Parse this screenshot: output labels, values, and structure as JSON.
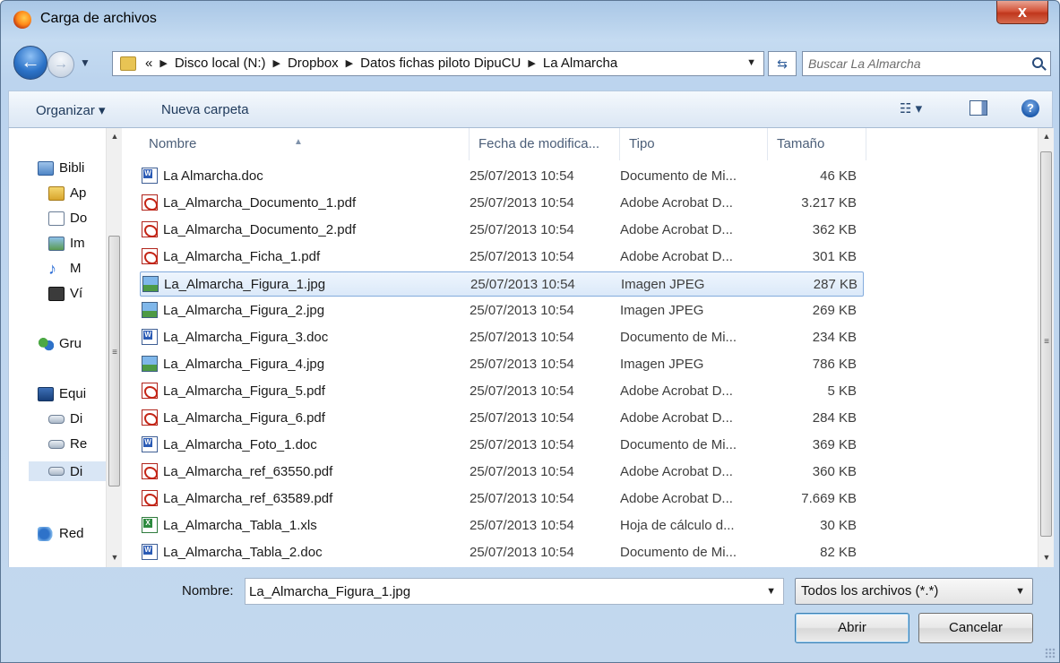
{
  "window": {
    "title": "Carga de archivos",
    "close_label": "x"
  },
  "address": {
    "overflow": "«",
    "crumbs": [
      "Disco local (N:)",
      "Dropbox",
      "Datos fichas piloto DipuCU",
      "La Almarcha"
    ],
    "search_placeholder": "Buscar La Almarcha"
  },
  "toolbar": {
    "organize": "Organizar ▾",
    "new_folder": "Nueva carpeta",
    "views": "☷ ▾",
    "help": "?"
  },
  "nav": {
    "items": [
      {
        "label": "Bibli",
        "icon": "library-icon"
      },
      {
        "label": "Ap",
        "icon": "folder-icon"
      },
      {
        "label": "Do",
        "icon": "document-icon"
      },
      {
        "label": "Im",
        "icon": "image-icon"
      },
      {
        "label": "M",
        "icon": "music-icon"
      },
      {
        "label": "Ví",
        "icon": "video-icon"
      },
      {
        "label": "Gru",
        "icon": "homegroup-icon"
      },
      {
        "label": "Equi",
        "icon": "computer-icon"
      },
      {
        "label": "Di",
        "icon": "drive-icon"
      },
      {
        "label": "Re",
        "icon": "drive-icon"
      },
      {
        "label": "Di",
        "icon": "drive-icon"
      },
      {
        "label": "Red",
        "icon": "network-icon"
      }
    ]
  },
  "columns": {
    "name": "Nombre",
    "date": "Fecha de modifica...",
    "type": "Tipo",
    "size": "Tamaño"
  },
  "files": [
    {
      "name": "La Almarcha.doc",
      "date": "25/07/2013 10:54",
      "type": "Documento de Mi...",
      "size": "46 KB",
      "kind": "doc"
    },
    {
      "name": "La_Almarcha_Documento_1.pdf",
      "date": "25/07/2013 10:54",
      "type": "Adobe Acrobat D...",
      "size": "3.217 KB",
      "kind": "pdf"
    },
    {
      "name": "La_Almarcha_Documento_2.pdf",
      "date": "25/07/2013 10:54",
      "type": "Adobe Acrobat D...",
      "size": "362 KB",
      "kind": "pdf"
    },
    {
      "name": "La_Almarcha_Ficha_1.pdf",
      "date": "25/07/2013 10:54",
      "type": "Adobe Acrobat D...",
      "size": "301 KB",
      "kind": "pdf"
    },
    {
      "name": "La_Almarcha_Figura_1.jpg",
      "date": "25/07/2013 10:54",
      "type": "Imagen JPEG",
      "size": "287 KB",
      "kind": "jpg",
      "selected": true
    },
    {
      "name": "La_Almarcha_Figura_2.jpg",
      "date": "25/07/2013 10:54",
      "type": "Imagen JPEG",
      "size": "269 KB",
      "kind": "jpg"
    },
    {
      "name": "La_Almarcha_Figura_3.doc",
      "date": "25/07/2013 10:54",
      "type": "Documento de Mi...",
      "size": "234 KB",
      "kind": "doc"
    },
    {
      "name": "La_Almarcha_Figura_4.jpg",
      "date": "25/07/2013 10:54",
      "type": "Imagen JPEG",
      "size": "786 KB",
      "kind": "jpg"
    },
    {
      "name": "La_Almarcha_Figura_5.pdf",
      "date": "25/07/2013 10:54",
      "type": "Adobe Acrobat D...",
      "size": "5 KB",
      "kind": "pdf"
    },
    {
      "name": "La_Almarcha_Figura_6.pdf",
      "date": "25/07/2013 10:54",
      "type": "Adobe Acrobat D...",
      "size": "284 KB",
      "kind": "pdf"
    },
    {
      "name": "La_Almarcha_Foto_1.doc",
      "date": "25/07/2013 10:54",
      "type": "Documento de Mi...",
      "size": "369 KB",
      "kind": "doc"
    },
    {
      "name": "La_Almarcha_ref_63550.pdf",
      "date": "25/07/2013 10:54",
      "type": "Adobe Acrobat D...",
      "size": "360 KB",
      "kind": "pdf"
    },
    {
      "name": "La_Almarcha_ref_63589.pdf",
      "date": "25/07/2013 10:54",
      "type": "Adobe Acrobat D...",
      "size": "7.669 KB",
      "kind": "pdf"
    },
    {
      "name": "La_Almarcha_Tabla_1.xls",
      "date": "25/07/2013 10:54",
      "type": "Hoja de cálculo d...",
      "size": "30 KB",
      "kind": "xls"
    },
    {
      "name": "La_Almarcha_Tabla_2.doc",
      "date": "25/07/2013 10:54",
      "type": "Documento de Mi...",
      "size": "82 KB",
      "kind": "doc"
    }
  ],
  "bottom": {
    "filename_label": "Nombre:",
    "filename_value": "La_Almarcha_Figura_1.jpg",
    "filter": "Todos los archivos (*.*)",
    "open": "Abrir",
    "cancel": "Cancelar"
  },
  "colors": {
    "selection": "#d9e8f8",
    "accent": "#3c7fb1"
  }
}
